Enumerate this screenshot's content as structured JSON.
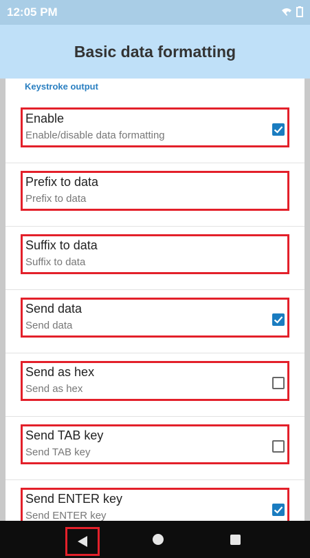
{
  "status_bar": {
    "time": "12:05 PM",
    "icons": [
      "wifi-icon",
      "battery-icon"
    ]
  },
  "app_bar": {
    "title": "Basic data formatting"
  },
  "section": {
    "header": "Keystroke output"
  },
  "settings": [
    {
      "title": "Enable",
      "subtitle": "Enable/disable data formatting",
      "checkbox": "checked"
    },
    {
      "title": "Prefix to data",
      "subtitle": "Prefix to data",
      "checkbox": "none"
    },
    {
      "title": "Suffix to data",
      "subtitle": "Suffix to data",
      "checkbox": "none"
    },
    {
      "title": "Send data",
      "subtitle": "Send data",
      "checkbox": "checked"
    },
    {
      "title": "Send as hex",
      "subtitle": "Send as hex",
      "checkbox": "unchecked"
    },
    {
      "title": "Send TAB key",
      "subtitle": "Send TAB key",
      "checkbox": "unchecked"
    },
    {
      "title": "Send ENTER key",
      "subtitle": "Send ENTER key",
      "checkbox": "checked"
    }
  ],
  "nav_bar": {
    "buttons": [
      "back-icon",
      "home-icon",
      "recents-icon"
    ]
  },
  "colors": {
    "status_bar": "#a9cde6",
    "app_bar": "#bfe0f8",
    "accent": "#1a7cc0",
    "highlight_box": "#e3202a",
    "section_header": "#2a7fc1"
  }
}
